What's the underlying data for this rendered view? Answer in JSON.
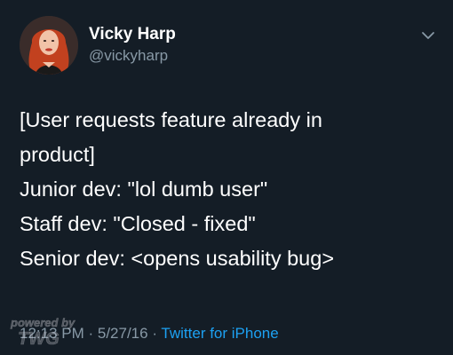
{
  "tweet": {
    "author": {
      "name": "Vicky Harp",
      "handle": "@vickyharp"
    },
    "menu_icon": "chevron-down-icon",
    "text_lines": [
      "[User requests feature already in",
      "product]",
      "Junior dev: \"lol dumb user\"",
      "Staff dev: \"Closed - fixed\"",
      "Senior dev: <opens usability bug>"
    ],
    "meta": {
      "time": "12:13 PM",
      "sep1": " · ",
      "date": "5/27/16",
      "sep2": " · ",
      "source": "Twitter for iPhone"
    }
  },
  "watermark": {
    "line1": "powered by",
    "line2": "TWG"
  },
  "colors": {
    "background": "#141d26",
    "primary_text": "#ffffff",
    "secondary_text": "#8899a6",
    "link": "#1da1f2"
  }
}
